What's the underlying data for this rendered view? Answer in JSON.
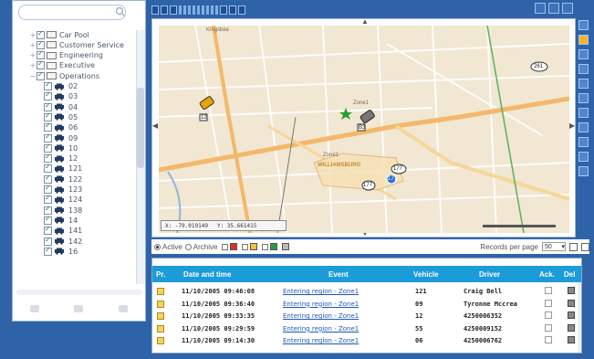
{
  "tree": {
    "items": [
      {
        "label": "Car Pool",
        "kind": "folder",
        "depth": 0
      },
      {
        "label": "Customer Service",
        "kind": "folder",
        "depth": 0
      },
      {
        "label": "Engineering",
        "kind": "folder",
        "depth": 0
      },
      {
        "label": "Executive",
        "kind": "folder",
        "depth": 0
      },
      {
        "label": "Operations",
        "kind": "folder",
        "depth": 0,
        "expanded": true
      },
      {
        "label": "02",
        "kind": "vehicle",
        "depth": 1
      },
      {
        "label": "03",
        "kind": "vehicle",
        "depth": 1
      },
      {
        "label": "04",
        "kind": "vehicle",
        "depth": 1
      },
      {
        "label": "05",
        "kind": "vehicle",
        "depth": 1
      },
      {
        "label": "06",
        "kind": "vehicle",
        "depth": 1
      },
      {
        "label": "09",
        "kind": "vehicle",
        "depth": 1
      },
      {
        "label": "10",
        "kind": "vehicle",
        "depth": 1
      },
      {
        "label": "12",
        "kind": "vehicle",
        "depth": 1
      },
      {
        "label": "121",
        "kind": "vehicle",
        "depth": 1
      },
      {
        "label": "122",
        "kind": "vehicle",
        "depth": 1
      },
      {
        "label": "123",
        "kind": "vehicle",
        "depth": 1
      },
      {
        "label": "124",
        "kind": "vehicle",
        "depth": 1
      },
      {
        "label": "138",
        "kind": "vehicle",
        "depth": 1
      },
      {
        "label": "14",
        "kind": "vehicle",
        "depth": 1
      },
      {
        "label": "141",
        "kind": "vehicle",
        "depth": 1
      },
      {
        "label": "142",
        "kind": "vehicle",
        "depth": 1
      },
      {
        "label": "16",
        "kind": "vehicle",
        "depth": 1
      }
    ]
  },
  "map": {
    "coords": {
      "x": "X: -79.019149",
      "y": "Y: 35.661415"
    },
    "place_labels": [
      "Kingsbee",
      "Zone1",
      "WILLIAMSBURG",
      "Zone1"
    ],
    "route_shields": [
      "261",
      "177",
      "177",
      "177"
    ],
    "marker_numbers": [
      "12",
      "B3"
    ]
  },
  "filter": {
    "active_label": "Active",
    "archive_label": "Archive",
    "active_selected": true,
    "records_label": "Records per page",
    "per_page": "50",
    "badge_colors": [
      "#d9342b",
      "#f0c040",
      "#2e9a3e"
    ]
  },
  "table": {
    "headers": {
      "priority": "Pr.",
      "date": "Date and time",
      "event": "Event",
      "vehicle": "Vehicle",
      "driver": "Driver",
      "ack": "Ack.",
      "del": "Del"
    },
    "rows": [
      {
        "date": "11/10/2005 09:46:08",
        "event": "Entering region - Zone1",
        "vehicle": "121",
        "driver": "Craig Bell"
      },
      {
        "date": "11/10/2005 09:36:40",
        "event": "Entering region - Zone1",
        "vehicle": "09",
        "driver": "Tyronne Mccrea"
      },
      {
        "date": "11/10/2005 09:33:35",
        "event": "Entering region - Zone1",
        "vehicle": "12",
        "driver": "4250006352"
      },
      {
        "date": "11/10/2005 09:29:59",
        "event": "Entering region - Zone1",
        "vehicle": "55",
        "driver": "4250009152"
      },
      {
        "date": "11/10/2005 09:14:30",
        "event": "Entering region - Zone1",
        "vehicle": "06",
        "driver": "4250006762"
      }
    ]
  },
  "colors": {
    "frame_blue": "#2f63a8",
    "header_blue": "#1b9bd8",
    "map_bg": "#f1e7d2",
    "priority": "#f6d25a"
  }
}
